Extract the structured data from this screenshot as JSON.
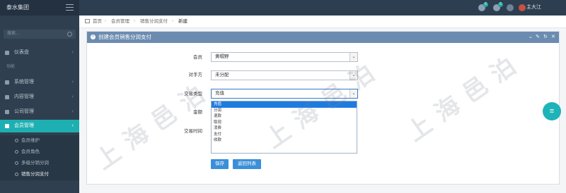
{
  "header": {
    "brand": "泰水集团",
    "user": "主大江",
    "badges": [
      "6",
      "5"
    ]
  },
  "sidebar": {
    "search_placeholder": "搜索...",
    "items": [
      {
        "label": "仪表盘",
        "icon": "dashboard-icon"
      },
      {
        "label": "功能",
        "icon": "section-header"
      },
      {
        "label": "系统管理",
        "icon": "gear-icon"
      },
      {
        "label": "内容管理",
        "icon": "file-icon"
      },
      {
        "label": "公司管理",
        "icon": "building-icon"
      },
      {
        "label": "会员管理",
        "icon": "diamond-icon",
        "active": true
      }
    ],
    "subitems": [
      {
        "label": "会员维护"
      },
      {
        "label": "会员角色"
      },
      {
        "label": "多级分销分润"
      },
      {
        "label": "销售分润支付",
        "current": true
      }
    ]
  },
  "breadcrumb": [
    "首页",
    "会员管理",
    "销售分润支付",
    "新建"
  ],
  "panel": {
    "title": "创建会员销售分润支付",
    "fields": [
      {
        "label": "会员",
        "value": "黄帽野",
        "type": "select"
      },
      {
        "label": "对手方",
        "value": "未分配",
        "type": "select"
      },
      {
        "label": "交易类型",
        "value": "充值",
        "type": "select-open"
      },
      {
        "label": "金额",
        "value": "",
        "type": "text"
      },
      {
        "label": "交易时间",
        "value": "",
        "type": "text"
      }
    ],
    "dropdown_options": [
      "充值",
      "分润",
      "退款",
      "取现",
      "消费",
      "支付",
      "收款"
    ],
    "selected_option": "充值",
    "save_label": "保存",
    "back_label": "返回列表"
  },
  "watermark": "上海邑泊",
  "colors": {
    "header_bg": "#2d3e50",
    "sidebar_bg": "#2f3f4f",
    "accent": "#1eafb2",
    "panel_head": "#6c8bb0",
    "button": "#3b8fd9",
    "option_selected": "#1e7be0"
  }
}
